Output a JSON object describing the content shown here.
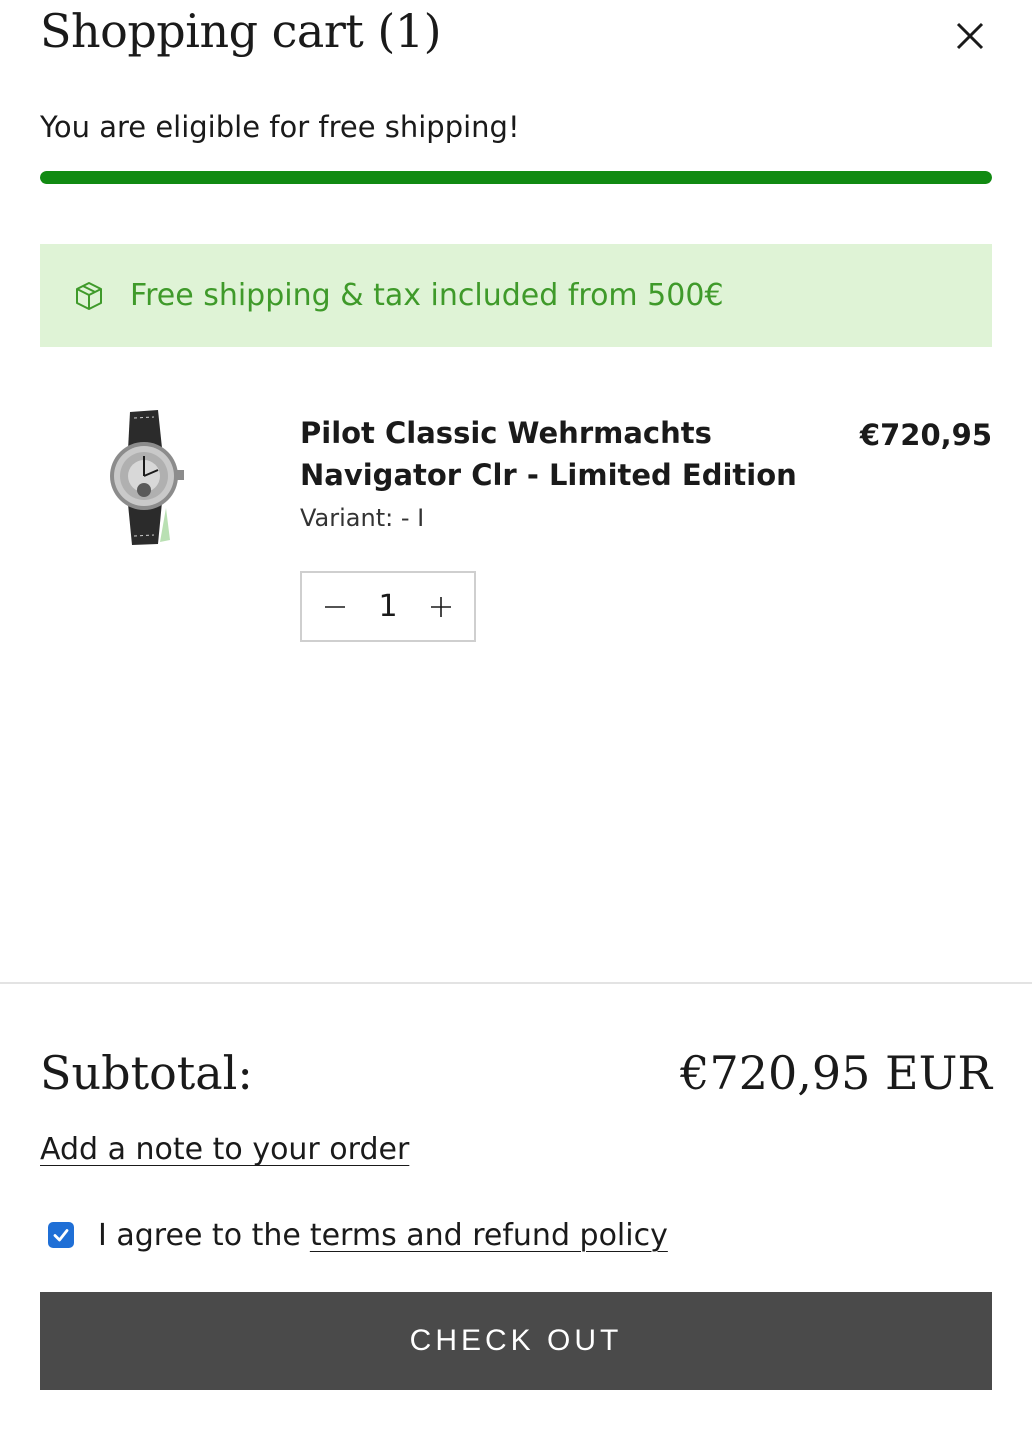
{
  "cart": {
    "title": "Shopping cart (1)",
    "close_icon": "close-icon"
  },
  "shipping": {
    "message": "You are eligible for free shipping!",
    "progress": 1.0,
    "progress_color": "#118a12"
  },
  "banner": {
    "icon": "package-icon",
    "text": "Free shipping & tax included from 500€",
    "background": "#dff3d6",
    "text_color": "#3f9a2a"
  },
  "items": [
    {
      "name": "Pilot Classic Wehrmachts Navigator Clr - Limited Edition",
      "price": "€720,95",
      "variant": "Variant: - I",
      "quantity": "1",
      "image_icon": "watch-image",
      "decrease_icon": "minus-icon",
      "increase_icon": "plus-icon"
    }
  ],
  "footer": {
    "subtotal_label": "Subtotal:",
    "subtotal_value": "€720,95 EUR",
    "note_link": "Add a note to your order",
    "agree_prefix": "I agree to the",
    "terms_link": "terms and refund policy",
    "agree_checked": true,
    "checkout_label": "CHECK OUT",
    "checkout_color": "#4a4a4a",
    "checkbox_color": "#1f6fd6"
  }
}
